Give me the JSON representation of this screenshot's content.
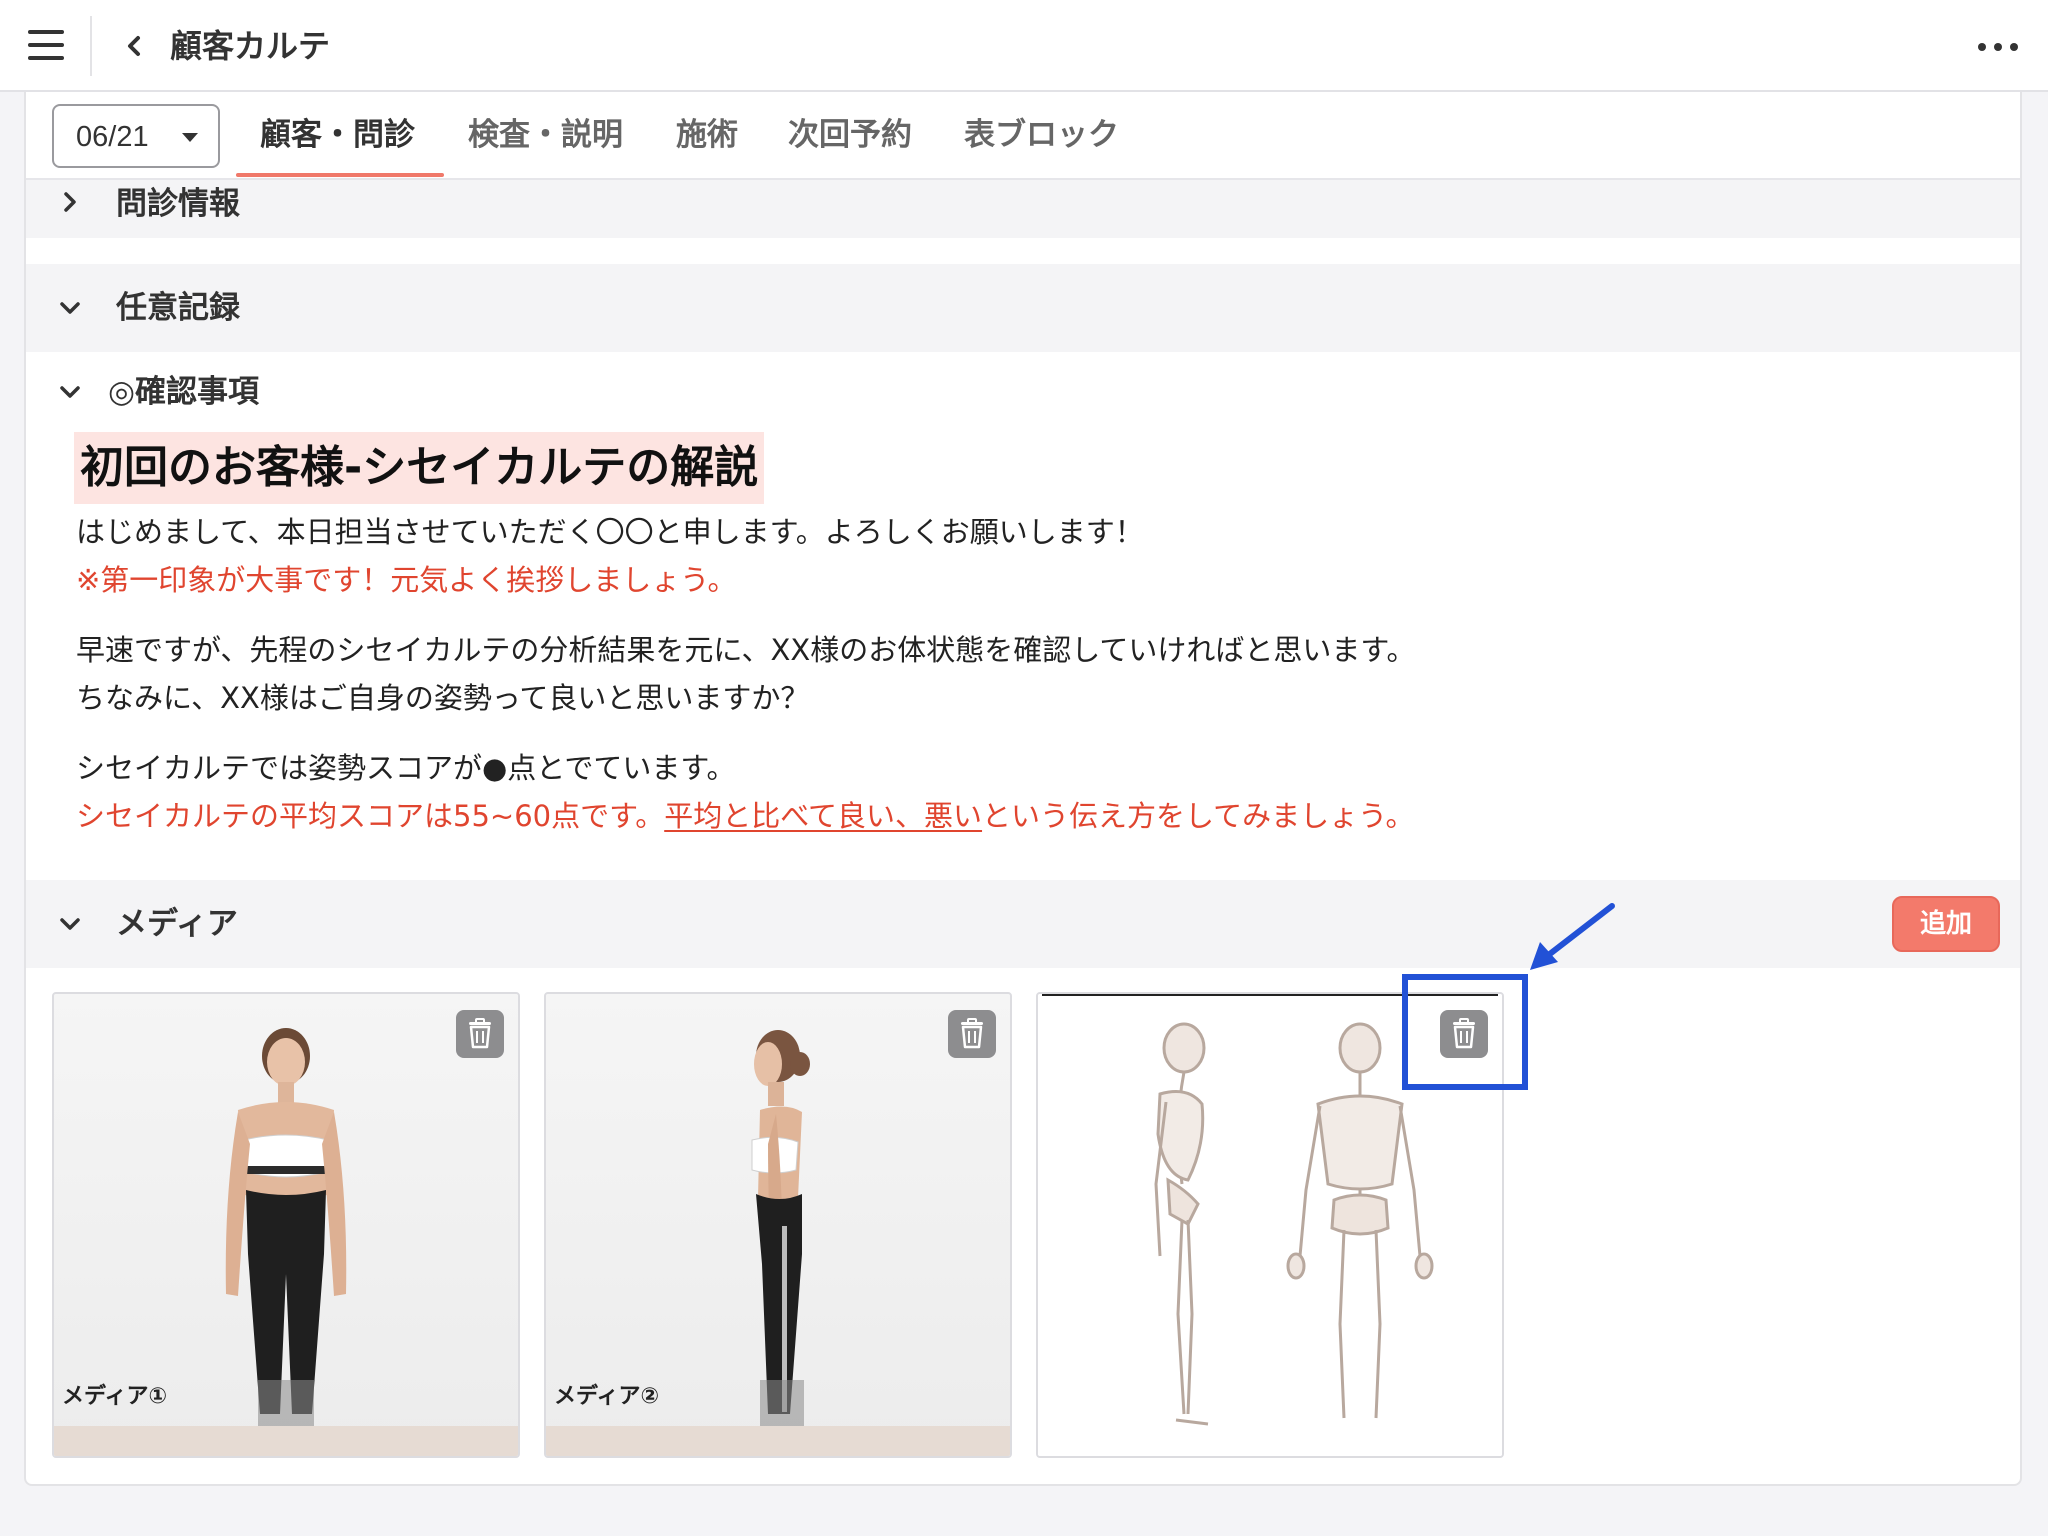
{
  "header": {
    "title": "顧客カルテ"
  },
  "tabs": {
    "date_value": "06/21",
    "items": [
      "顧客・問診",
      "検査・説明",
      "施術",
      "次回予約",
      "表ブロック"
    ],
    "active_index": 0
  },
  "sections": {
    "monshin": "問診情報",
    "nini": "任意記録",
    "kakunin": "◎確認事項",
    "media": "メディア"
  },
  "content": {
    "heading": "初回のお客様-シセイカルテの解説",
    "line1": "はじめまして、本日担当させていただく〇〇と申します。よろしくお願いします！",
    "line2_red": "※第一印象が大事です！元気よく挨拶しましょう。",
    "line3": "早速ですが、先程のシセイカルテの分析結果を元に、XX様のお体状態を確認していければと思います。",
    "line4": "ちなみに、XX様はご自身の姿勢って良いと思いますか？",
    "line5": "シセイカルテでは姿勢スコアが●点とでています。",
    "line6_red_a": "シセイカルテの平均スコアは55~60点です。",
    "line6_red_underline": "平均と比べて良い、悪い",
    "line6_red_b": "という伝え方をしてみましょう。"
  },
  "media": {
    "add_label": "追加",
    "items": [
      {
        "label": "メディア①"
      },
      {
        "label": "メディア②"
      },
      {
        "label": ""
      }
    ]
  },
  "colors": {
    "accent": "#f0796a",
    "red_text": "#e0452f",
    "highlight": "#fde4e1",
    "annotation": "#2251d6"
  }
}
